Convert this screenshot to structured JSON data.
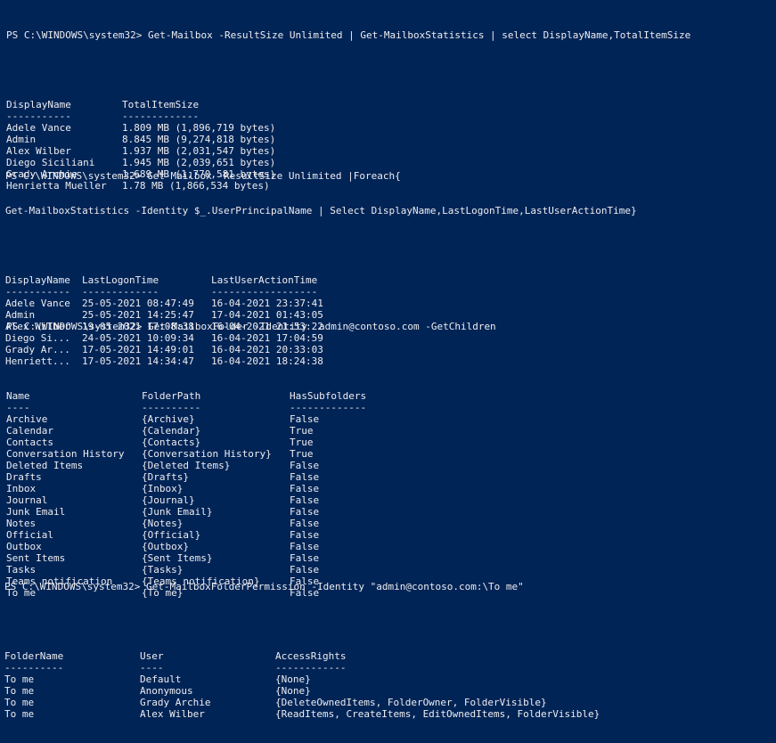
{
  "colors": {
    "background": "#012456",
    "foreground": "#eeedf0"
  },
  "prompt": "PS C:\\WINDOWS\\system32> ",
  "sections": [
    {
      "command_lines": [
        "Get-Mailbox -ResultSize Unlimited | Get-MailboxStatistics | select DisplayName,TotalItemSize"
      ],
      "headers": [
        "DisplayName",
        "TotalItemSize"
      ],
      "underlines": [
        "-----------",
        "-------------"
      ],
      "rows": [
        [
          "Adele Vance",
          "1.809 MB (1,896,719 bytes)"
        ],
        [
          "Admin",
          "8.845 MB (9,274,818 bytes)"
        ],
        [
          "Alex Wilber",
          "1.937 MB (2,031,547 bytes)"
        ],
        [
          "Diego Siciliani",
          "1.945 MB (2,039,651 bytes)"
        ],
        [
          "Grady Archie",
          "1.689 MB (1,770,581 bytes)"
        ],
        [
          "Henrietta Mueller",
          "1.78 MB (1,866,534 bytes)"
        ]
      ]
    },
    {
      "command_lines": [
        "Get-Mailbox -ResultSize Unlimited |Foreach{",
        "Get-MailboxStatistics -Identity $_.UserPrincipalName | Select DisplayName,LastLogonTime,LastUserActionTime}"
      ],
      "headers": [
        "DisplayName",
        "LastLogonTime",
        "LastUserActionTime"
      ],
      "underlines": [
        "-----------",
        "-------------",
        "------------------"
      ],
      "rows": [
        [
          "Adele Vance",
          "25-05-2021 08:47:49",
          "16-04-2021 23:37:41"
        ],
        [
          "Admin",
          "25-05-2021 14:25:47",
          "17-04-2021 01:43:05"
        ],
        [
          "Alex Wilber",
          "19-05-2021 17:08:38",
          "16-04-2021 21:53:22"
        ],
        [
          "Diego Si...",
          "24-05-2021 10:09:34",
          "16-04-2021 17:04:59"
        ],
        [
          "Grady Ar...",
          "17-05-2021 14:49:01",
          "16-04-2021 20:33:03"
        ],
        [
          "Henriett...",
          "17-05-2021 14:34:47",
          "16-04-2021 18:24:38"
        ]
      ]
    },
    {
      "command_lines": [
        "Get-MailboxFolder -Identity  admin@contoso.com -GetChildren"
      ],
      "headers": [
        "Name",
        "FolderPath",
        "HasSubfolders"
      ],
      "underlines": [
        "----",
        "----------",
        "-------------"
      ],
      "rows": [
        [
          "Archive",
          "{Archive}",
          "False"
        ],
        [
          "Calendar",
          "{Calendar}",
          "True"
        ],
        [
          "Contacts",
          "{Contacts}",
          "True"
        ],
        [
          "Conversation History",
          "{Conversation History}",
          "True"
        ],
        [
          "Deleted Items",
          "{Deleted Items}",
          "False"
        ],
        [
          "Drafts",
          "{Drafts}",
          "False"
        ],
        [
          "Inbox",
          "{Inbox}",
          "False"
        ],
        [
          "Journal",
          "{Journal}",
          "False"
        ],
        [
          "Junk Email",
          "{Junk Email}",
          "False"
        ],
        [
          "Notes",
          "{Notes}",
          "False"
        ],
        [
          "Official",
          "{Official}",
          "False"
        ],
        [
          "Outbox",
          "{Outbox}",
          "False"
        ],
        [
          "Sent Items",
          "{Sent Items}",
          "False"
        ],
        [
          "Tasks",
          "{Tasks}",
          "False"
        ],
        [
          "Teams notification",
          "{Teams notification}",
          "False"
        ],
        [
          "To me",
          "{To me}",
          "False"
        ]
      ]
    },
    {
      "command_lines": [
        "Get-MailboxFolderPermission -Identity \"admin@contoso.com:\\To me\""
      ],
      "headers": [
        "FolderName",
        "User",
        "AccessRights"
      ],
      "underlines": [
        "----------",
        "----",
        "------------"
      ],
      "rows": [
        [
          "To me",
          "Default",
          "{None}"
        ],
        [
          "To me",
          "Anonymous",
          "{None}"
        ],
        [
          "To me",
          "Grady Archie",
          "{DeleteOwnedItems, FolderOwner, FolderVisible}"
        ],
        [
          "To me",
          "Alex Wilber",
          "{ReadItems, CreateItems, EditOwnedItems, FolderVisible}"
        ]
      ]
    }
  ]
}
